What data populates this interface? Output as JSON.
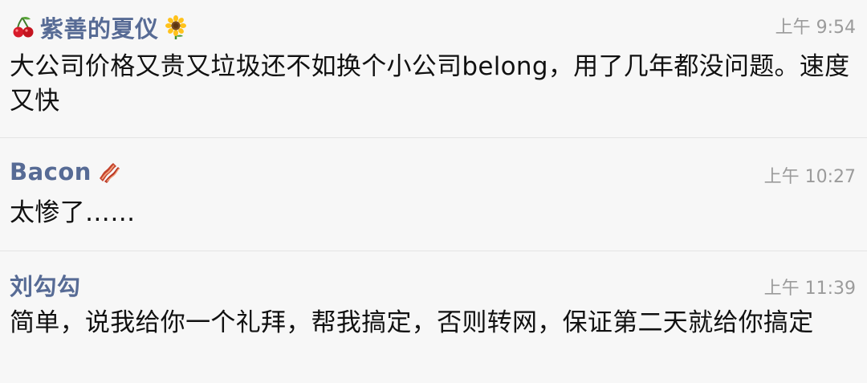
{
  "messages": [
    {
      "name": "紫善的夏仪",
      "name_icons": [
        "cherry-icon",
        "sunflower-icon"
      ],
      "time": "上午 9:54",
      "content": "大公司价格又贵又垃圾还不如换个小公司belong，用了几年都没问题。速度又快"
    },
    {
      "name": "Bacon",
      "name_icons": [
        "bacon-icon"
      ],
      "time": "上午 10:27",
      "content": "太惨了……"
    },
    {
      "name": "刘勾勾",
      "name_icons": [],
      "time": "上午 11:39",
      "content": "简单，说我给你一个礼拜，帮我搞定，否则转网，保证第二天就给你搞定"
    }
  ],
  "colors": {
    "background": "#f7f7f7",
    "name": "#576b95",
    "time": "#9b9b9b",
    "content": "#111111",
    "divider": "#e4e4e4"
  }
}
